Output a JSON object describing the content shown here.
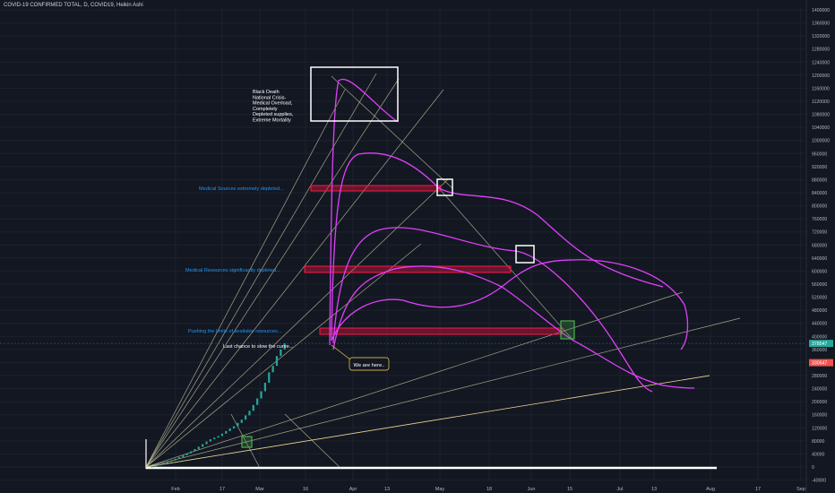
{
  "header": {
    "title": "COVID-19 CONFIRMED TOTAL, D, COVID19, Heikin Ashi"
  },
  "chart_data": {
    "type": "line",
    "title": "COVID-19 CONFIRMED TOTAL, D, COVID19, Heikin Ashi",
    "xlabel": "",
    "ylabel": "",
    "x_ticks": [
      "Feb",
      "17",
      "Mar",
      "16",
      "Apr",
      "13",
      "May",
      "18",
      "Jun",
      "15",
      "Jul",
      "13",
      "Aug",
      "17",
      "Sep"
    ],
    "y_ticks": [
      1400000,
      1360000,
      1320000,
      1280000,
      1240000,
      1200000,
      1160000,
      1120000,
      1080000,
      1040000,
      1000000,
      960000,
      920000,
      880000,
      840000,
      800000,
      760000,
      720000,
      680000,
      640000,
      600000,
      560000,
      520000,
      480000,
      440000,
      400000,
      360000,
      320000,
      280000,
      240000,
      200000,
      160000,
      120000,
      80000,
      40000,
      0,
      -40000
    ],
    "ylim": [
      -40000,
      1420000
    ],
    "grid": true,
    "price_labels": [
      "378547",
      "330547"
    ],
    "annotations": [
      "Black Death National Crisis- Medical Overload, Completely Depleted supplies, Extreme Mortality",
      "Medical Sources extremely depleted...",
      "Medical Resources significantly depleted...",
      "Pushing the limits of available resources...",
      "Last chance to slow the curve...",
      "We are here.."
    ],
    "colors": {
      "background": "#131722",
      "grid": "#1e222d",
      "candles": "#26a69a",
      "projection_curves": "#e040fb",
      "fan_lines": "#d4d4a8",
      "resource_zones": "#ff1744",
      "annotation_text": "#2196f3",
      "boxes": "#ffffff",
      "marker_boxes": "#4caf50"
    },
    "confirmed_total": {
      "name": "COVID-19 CONFIRMED TOTAL",
      "x": [
        0,
        2,
        4,
        6,
        8,
        10,
        12,
        14,
        16,
        18,
        20,
        22,
        24,
        26,
        28,
        30,
        32,
        34,
        36,
        38,
        40,
        42,
        44,
        46,
        48,
        50,
        52,
        54,
        56,
        58,
        60,
        62,
        64,
        66,
        68,
        70
      ],
      "values": [
        0,
        2000,
        5000,
        8000,
        12000,
        16000,
        20000,
        25000,
        30000,
        36000,
        42000,
        48000,
        55000,
        62000,
        70000,
        78000,
        85000,
        90000,
        95000,
        102000,
        110000,
        118000,
        125000,
        135000,
        145000,
        158000,
        172000,
        190000,
        210000,
        232000,
        258000,
        290000,
        310000,
        340000,
        360000,
        378547
      ]
    },
    "projections": [
      {
        "x": [
          70,
          71,
          73,
          75,
          78,
          82,
          88,
          95,
          100,
          105,
          110,
          115,
          118,
          120
        ],
        "values": [
          380000,
          700000,
          1100000,
          1180000,
          1200000,
          1180000,
          1130000,
          1060000,
          1000000,
          940000,
          880000,
          860000,
          855000,
          850000
        ]
      },
      {
        "x": [
          70,
          72,
          74,
          78,
          85,
          93,
          101,
          107,
          113,
          118,
          124,
          130,
          137,
          143
        ],
        "values": [
          390000,
          600000,
          860000,
          940000,
          975000,
          980000,
          960000,
          940000,
          910000,
          880000,
          860000,
          860000,
          845000,
          820000
        ]
      },
      {
        "x": [
          70,
          72,
          75,
          80,
          88,
          95,
          101,
          107,
          113,
          119,
          125,
          131,
          137,
          143,
          148,
          155,
          162,
          168,
          174,
          180,
          186,
          192,
          198,
          204,
          210,
          216,
          222,
          228
        ],
        "values": [
          400000,
          500000,
          620000,
          720000,
          760000,
          770000,
          760000,
          740000,
          730000,
          720000,
          700000,
          690000,
          670000,
          640000,
          610000,
          570000,
          530000,
          490000,
          460000,
          440000,
          420000,
          400000,
          380000,
          360000,
          340000,
          310000,
          280000,
          240000
        ]
      },
      {
        "x": [
          70,
          73,
          78,
          84,
          92,
          100,
          108,
          116,
          124,
          132,
          140,
          148,
          155,
          162,
          170,
          180,
          190,
          200,
          210,
          220,
          230,
          236,
          240,
          242
        ],
        "values": [
          410000,
          560000,
          640000,
          680000,
          690000,
          680000,
          670000,
          690000,
          700000,
          690000,
          660000,
          630000,
          580000,
          540000,
          520000,
          510000,
          500000,
          480000,
          460000,
          440000,
          400000,
          360000,
          320000,
          280000
        ]
      },
      {
        "x": [
          70,
          72,
          75,
          80,
          88,
          95,
          102,
          110,
          118,
          125,
          132,
          140,
          148,
          155,
          162,
          170,
          180,
          190,
          200,
          210,
          220,
          228,
          234,
          240,
          242
        ],
        "values": [
          400000,
          450000,
          500000,
          520000,
          510000,
          490000,
          480000,
          470000,
          480000,
          520000,
          560000,
          600000,
          630000,
          640000,
          640000,
          640000,
          640000,
          630000,
          610000,
          580000,
          540000,
          480000,
          420000,
          380000,
          350000
        ]
      }
    ]
  }
}
